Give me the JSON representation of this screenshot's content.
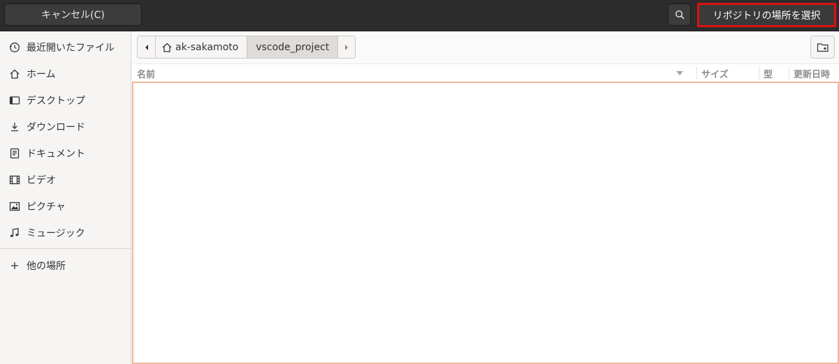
{
  "header": {
    "cancel_label": "キャンセル(C)",
    "select_label": "リポジトリの場所を選択"
  },
  "sidebar": {
    "items": [
      {
        "label": "最近開いたファイル",
        "icon": "clock-icon"
      },
      {
        "label": "ホーム",
        "icon": "home-icon"
      },
      {
        "label": "デスクトップ",
        "icon": "desktop-icon"
      },
      {
        "label": "ダウンロード",
        "icon": "download-icon"
      },
      {
        "label": "ドキュメント",
        "icon": "document-icon"
      },
      {
        "label": "ビデオ",
        "icon": "video-icon"
      },
      {
        "label": "ピクチャ",
        "icon": "picture-icon"
      },
      {
        "label": "ミュージック",
        "icon": "music-icon"
      }
    ],
    "other_locations": {
      "label": "他の場所",
      "icon": "plus-icon"
    }
  },
  "pathbar": {
    "home_label": "ak-sakamoto",
    "current_label": "vscode_project"
  },
  "columns": {
    "name": "名前",
    "size": "サイズ",
    "type": "型",
    "modified": "更新日時"
  },
  "colors": {
    "header_bg": "#2c2c2c",
    "highlight_border": "#e01010",
    "focus_border": "#f0b79a"
  }
}
